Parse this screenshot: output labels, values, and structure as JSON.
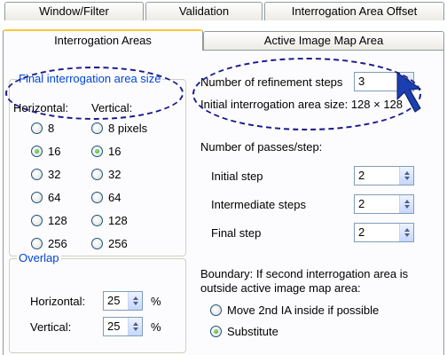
{
  "tabs_back": [
    "Window/Filter",
    "Validation",
    "Interrogation Area Offset"
  ],
  "tabs_front": [
    "Interrogation Areas",
    "Active Image Map Area"
  ],
  "final_size": {
    "legend": "Final interrogation area size",
    "horizontal_label": "Horizontal:",
    "vertical_label": "Vertical:",
    "horizontal_options": [
      "8",
      "16",
      "32",
      "64",
      "128",
      "256"
    ],
    "vertical_options": [
      "8 pixels",
      "16",
      "32",
      "64",
      "128",
      "256"
    ],
    "horizontal_selected": "16",
    "vertical_selected": "16"
  },
  "refinement": {
    "label": "Number of refinement steps",
    "value": "3",
    "initial_size_label": "Initial interrogation area size: 128 × 128"
  },
  "passes": {
    "title": "Number of passes/step:",
    "initial_label": "Initial step",
    "initial_value": "2",
    "intermediate_label": "Intermediate steps",
    "intermediate_value": "2",
    "final_label": "Final step",
    "final_value": "2"
  },
  "overlap": {
    "legend": "Overlap",
    "horizontal_label": "Horizontal:",
    "horizontal_value": "25",
    "vertical_label": "Vertical:",
    "vertical_value": "25",
    "unit": "%"
  },
  "boundary": {
    "line1": "Boundary: If second interrogation area is",
    "line2": "outside active image map area:",
    "option_move": "Move 2nd IA inside if possible",
    "option_substitute": "Substitute",
    "selected": "Substitute"
  },
  "colors": {
    "legend_text": "#0046d5",
    "annotation": "#1a1a8c",
    "radio_selected": "#21a121",
    "active_tab_highlight": "#ffc83c"
  }
}
